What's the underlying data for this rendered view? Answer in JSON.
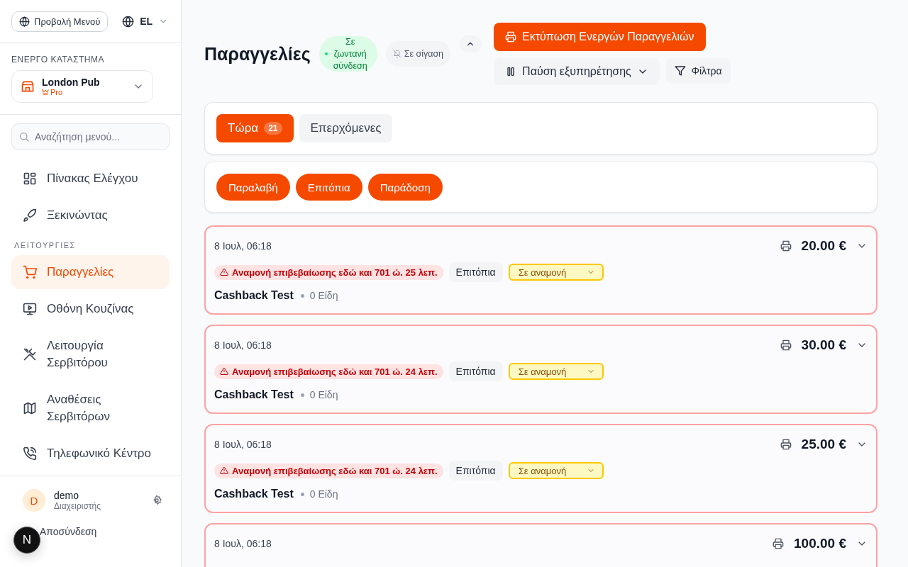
{
  "sidebar": {
    "menu_view_button": "Προβολή Μενού",
    "language": "EL",
    "store_section_label": "ΕΝΕΡΓΟ ΚΑΤΑΣΤΗΜΑ",
    "store": {
      "name": "London Pub",
      "plan": "Pro"
    },
    "search": {
      "placeholder": "Αναζήτηση μενού..."
    },
    "nav": [
      {
        "kind": "item",
        "label": "Πίνακας Ελέγχου",
        "selected": false
      },
      {
        "kind": "item",
        "label": "Ξεκινώντας",
        "selected": false
      },
      {
        "kind": "section",
        "label": "ΛΕΙΤΟΥΡΓΙΕΣ"
      },
      {
        "kind": "item",
        "label": "Παραγγελίες",
        "selected": true
      },
      {
        "kind": "item",
        "label": "Οθόνη Κουζίνας",
        "selected": false
      },
      {
        "kind": "item",
        "label": "Λειτουργία Σερβιτόρου",
        "selected": false
      },
      {
        "kind": "item",
        "label": "Αναθέσεις Σερβιτόρων",
        "selected": false
      },
      {
        "kind": "item",
        "label": "Τηλεφωνικό Κέντρο",
        "selected": false
      }
    ],
    "user": {
      "initial": "D",
      "name": "demo",
      "role": "Διαχειριστής"
    },
    "logout": "Αποσύνδεση"
  },
  "dev_badge": "N",
  "header": {
    "title": "Παραγγελίες",
    "live_status": "Σε ζωντανή σύνδεση",
    "mute_status": "Σε σίγαση",
    "print_button": "Εκτύπωση Ενεργών Παραγγελιών",
    "pause_button": "Παύση εξυπηρέτησης",
    "filters_button": "Φίλτρα"
  },
  "tabs": [
    {
      "label": "Τώρα",
      "count": "21",
      "selected": true
    },
    {
      "label": "Επερχόμενες",
      "selected": false
    }
  ],
  "order_types": [
    {
      "label": "Παραλαβή",
      "selected": true
    },
    {
      "label": "Επιτόπια",
      "selected": true
    },
    {
      "label": "Παράδοση",
      "selected": true
    }
  ],
  "orders": [
    {
      "time": "8 Ιουλ, 06:18",
      "amount": "20.00 €",
      "warning": "Αναμονή επιβεβαίωσης εδώ και 701 ώ. 25 λεπ.",
      "type": "Επιτόπια",
      "status": "Σε αναμονή",
      "customer": "Cashback Test",
      "items": "0 Είδη"
    },
    {
      "time": "8 Ιουλ, 06:18",
      "amount": "30.00 €",
      "warning": "Αναμονή επιβεβαίωσης εδώ και 701 ώ. 24 λεπ.",
      "type": "Επιτόπια",
      "status": "Σε αναμονή",
      "customer": "Cashback Test",
      "items": "0 Είδη"
    },
    {
      "time": "8 Ιουλ, 06:18",
      "amount": "25.00 €",
      "warning": "Αναμονή επιβεβαίωσης εδώ και 701 ώ. 24 λεπ.",
      "type": "Επιτόπια",
      "status": "Σε αναμονή",
      "customer": "Cashback Test",
      "items": "0 Είδη"
    },
    {
      "time": "8 Ιουλ, 06:18",
      "amount": "100.00 €"
    }
  ]
}
